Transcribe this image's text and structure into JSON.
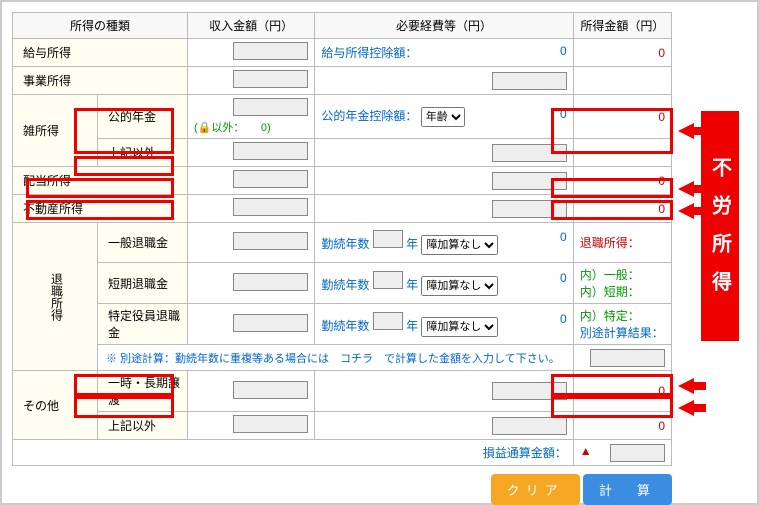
{
  "headers": {
    "type": "所得の種類",
    "income": "収入金額（円）",
    "expense": "必要経費等（円）",
    "amount": "所得金額（円）"
  },
  "rows": {
    "salary": {
      "label": "給与所得",
      "expense_label": "給与所得控除額：",
      "expense_val": "0",
      "amount": "0"
    },
    "business": {
      "label": "事業所得"
    },
    "misc": {
      "group": "雑所得",
      "pension": "公的年金",
      "other": "上記以外",
      "note_prefix": "以外：",
      "note_val": "0",
      "pension_label": "公的年金控除額：",
      "pension_sel": "年齢",
      "pension_val": "0",
      "pension_amt": "0"
    },
    "dividend": {
      "label": "配当所得",
      "amount": "0"
    },
    "realestate": {
      "label": "不動産所得",
      "amount": "0"
    },
    "retire": {
      "group": "退職所得",
      "r1": "一般退職金",
      "r2": "短期退職金",
      "r3": "特定役員退職金",
      "years_label": "勤続年数",
      "years_unit": "年",
      "sel": "障加算なし",
      "zero": "0",
      "side1": "退職所得：",
      "side2": "内）一般：",
      "side3": "内）短期：",
      "side4": "内）特定：",
      "side5": "別途計算結果：",
      "note": "※ 別途計算：勤続年数に重複等ある場合には　コチラ　で計算した金額を入力して下さい。"
    },
    "other": {
      "group": "その他",
      "o1": "一時・長期譲渡",
      "o2": "上記以外",
      "amt1": "0",
      "amt2": "0"
    },
    "total": {
      "label": "損益通算金額：",
      "mark": "▲"
    }
  },
  "buttons": {
    "clear": "クリア",
    "calc": "計　算"
  },
  "sidebar": "不労所得",
  "icon_label": "鍵"
}
